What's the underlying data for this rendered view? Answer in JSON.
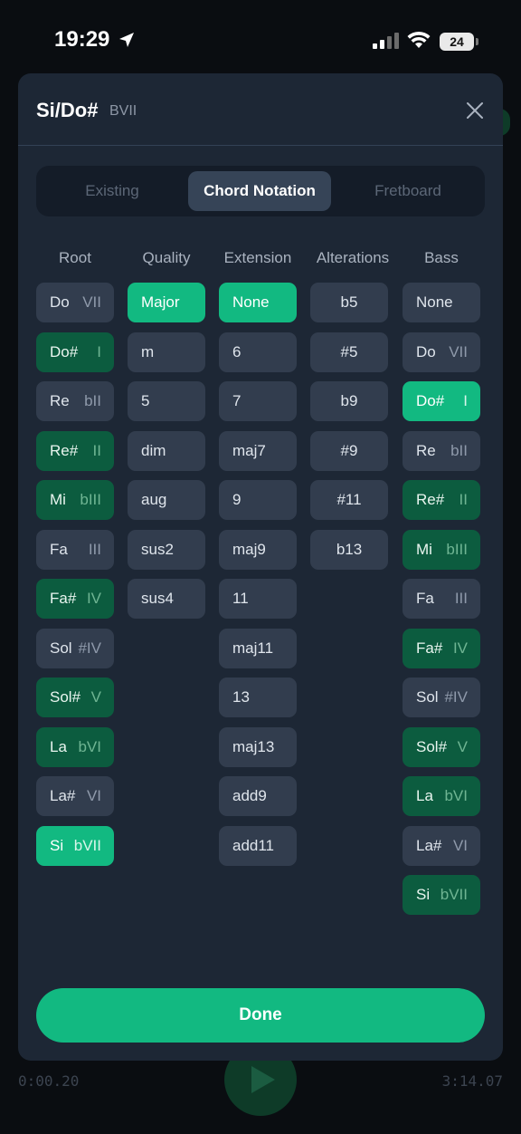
{
  "status_bar": {
    "time": "19:29",
    "battery": "24"
  },
  "background": {
    "time_elapsed": "0:00.20",
    "time_total": "3:14.07"
  },
  "modal": {
    "title": "Si/Do#",
    "subtitle": "BVII",
    "tabs": [
      {
        "label": "Existing",
        "active": false
      },
      {
        "label": "Chord Notation",
        "active": true
      },
      {
        "label": "Fretboard",
        "active": false
      }
    ],
    "columns": {
      "root": {
        "header": "Root",
        "items": [
          {
            "note": "Do",
            "roman": "VII",
            "state": "normal"
          },
          {
            "note": "Do#",
            "roman": "I",
            "state": "in-key"
          },
          {
            "note": "Re",
            "roman": "bII",
            "state": "normal"
          },
          {
            "note": "Re#",
            "roman": "II",
            "state": "in-key"
          },
          {
            "note": "Mi",
            "roman": "bIII",
            "state": "in-key"
          },
          {
            "note": "Fa",
            "roman": "III",
            "state": "normal"
          },
          {
            "note": "Fa#",
            "roman": "IV",
            "state": "in-key"
          },
          {
            "note": "Sol",
            "roman": "#IV",
            "state": "normal"
          },
          {
            "note": "Sol#",
            "roman": "V",
            "state": "in-key"
          },
          {
            "note": "La",
            "roman": "bVI",
            "state": "in-key"
          },
          {
            "note": "La#",
            "roman": "VI",
            "state": "normal"
          },
          {
            "note": "Si",
            "roman": "bVII",
            "state": "selected"
          }
        ]
      },
      "quality": {
        "header": "Quality",
        "items": [
          {
            "label": "Major",
            "state": "selected"
          },
          {
            "label": "m",
            "state": "normal"
          },
          {
            "label": "5",
            "state": "normal"
          },
          {
            "label": "dim",
            "state": "normal"
          },
          {
            "label": "aug",
            "state": "normal"
          },
          {
            "label": "sus2",
            "state": "normal"
          },
          {
            "label": "sus4",
            "state": "normal"
          }
        ]
      },
      "extension": {
        "header": "Extension",
        "items": [
          {
            "label": "None",
            "state": "selected"
          },
          {
            "label": "6",
            "state": "normal"
          },
          {
            "label": "7",
            "state": "normal"
          },
          {
            "label": "maj7",
            "state": "normal"
          },
          {
            "label": "9",
            "state": "normal"
          },
          {
            "label": "maj9",
            "state": "normal"
          },
          {
            "label": "11",
            "state": "normal"
          },
          {
            "label": "maj11",
            "state": "normal"
          },
          {
            "label": "13",
            "state": "normal"
          },
          {
            "label": "maj13",
            "state": "normal"
          },
          {
            "label": "add9",
            "state": "normal"
          },
          {
            "label": "add11",
            "state": "normal"
          }
        ]
      },
      "alterations": {
        "header": "Alterations",
        "items": [
          {
            "label": "b5",
            "state": "normal"
          },
          {
            "label": "#5",
            "state": "normal"
          },
          {
            "label": "b9",
            "state": "normal"
          },
          {
            "label": "#9",
            "state": "normal"
          },
          {
            "label": "#11",
            "state": "normal"
          },
          {
            "label": "b13",
            "state": "normal"
          }
        ]
      },
      "bass": {
        "header": "Bass",
        "items": [
          {
            "note": "None",
            "roman": "",
            "state": "normal"
          },
          {
            "note": "Do",
            "roman": "VII",
            "state": "normal"
          },
          {
            "note": "Do#",
            "roman": "I",
            "state": "selected"
          },
          {
            "note": "Re",
            "roman": "bII",
            "state": "normal"
          },
          {
            "note": "Re#",
            "roman": "II",
            "state": "in-key"
          },
          {
            "note": "Mi",
            "roman": "bIII",
            "state": "in-key"
          },
          {
            "note": "Fa",
            "roman": "III",
            "state": "normal"
          },
          {
            "note": "Fa#",
            "roman": "IV",
            "state": "in-key"
          },
          {
            "note": "Sol",
            "roman": "#IV",
            "state": "normal"
          },
          {
            "note": "Sol#",
            "roman": "V",
            "state": "in-key"
          },
          {
            "note": "La",
            "roman": "bVI",
            "state": "in-key"
          },
          {
            "note": "La#",
            "roman": "VI",
            "state": "normal"
          },
          {
            "note": "Si",
            "roman": "bVII",
            "state": "in-key"
          }
        ]
      }
    },
    "done_label": "Done"
  },
  "colors": {
    "accent": "#12b981",
    "in_key": "#0c5c3f",
    "button": "#323d4e",
    "modal_bg": "#1d2735"
  }
}
